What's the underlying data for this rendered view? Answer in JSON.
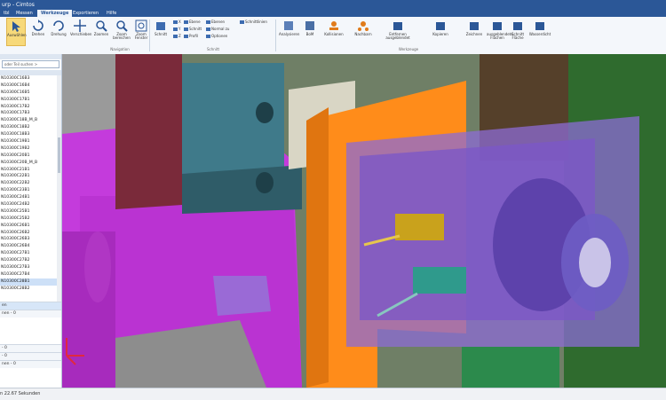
{
  "window": {
    "title": "urp - Cimtos"
  },
  "tabs": [
    "tbl",
    "Messen",
    "Werkzeuge",
    "Exportieren",
    "Hilfe"
  ],
  "active_tab": "Werkzeuge",
  "ribbon": {
    "select": "Auswählen",
    "rotate": "Drehen",
    "revolve": "Drehung",
    "move": "Verschieben",
    "zoom_in": "Zoomen",
    "zoom_area": "Zoom bereichen",
    "zoom_window": "Zoom Fenster",
    "section": "Schnitt",
    "cut_items": [
      "X",
      "Y",
      "Z",
      "Ebene",
      "Schnitt",
      "Profil",
      "Ebenen",
      "Normal zu",
      "Optionen",
      "Schnittlinien"
    ],
    "analyze": "Analysieren",
    "bom": "BoM",
    "edit_assembly": "Kollisionen",
    "neighbors": "Nachbarn",
    "remove_hidden": "Entfernen ausgeblendet",
    "copy": "Kopieren",
    "export_group": "Exp. kopieren",
    "drawing": "Zeichnen",
    "hide": "ausgeblendete Flächen",
    "cut_area": "Schnitt Fläche",
    "watertight": "Wasserdicht",
    "groups": [
      "Navigation",
      "Schnitt",
      "Werkzeuge"
    ]
  },
  "leftpanel": {
    "search_placeholder": "oder Teil suchen",
    "items": [
      "N10300C16B3",
      "N10300C16B4",
      "N10300C16B5",
      "N10300C17B1",
      "N10300C17B2",
      "N10300C17B3",
      "N10300C18B_M_B",
      "N10300C18B2",
      "N10300C18B3",
      "N10300C19B1",
      "N10300C19B2",
      "N10300C20B1",
      "N10300C20B_M_B",
      "N10300C21B1",
      "N10300C22B1",
      "N10300C22B2",
      "N10300C23B1",
      "N10300C24B1",
      "N10300C24B2",
      "N10300C25B1",
      "N10300C25B2",
      "N10300C26B1",
      "N10300C26B2",
      "N10300C26B3",
      "N10300C26B4",
      "N10300C27B1",
      "N10300C27B2",
      "N10300C27B3",
      "N10300C27B4",
      "N10300C28B1",
      "N10300C28B2"
    ],
    "sections": [
      "en",
      "nen - 0",
      "- 0",
      "- 0",
      "nen - 0"
    ]
  },
  "status": {
    "text": "n 22.67 Sekunden"
  },
  "colors": {
    "title": "#2b5797",
    "magenta": "#c43bdc",
    "teal": "#3f7a8a",
    "orange": "#ff8c1a",
    "olive": "#7d8a55",
    "purple": "#7c57c7",
    "darkred": "#6e2234"
  }
}
